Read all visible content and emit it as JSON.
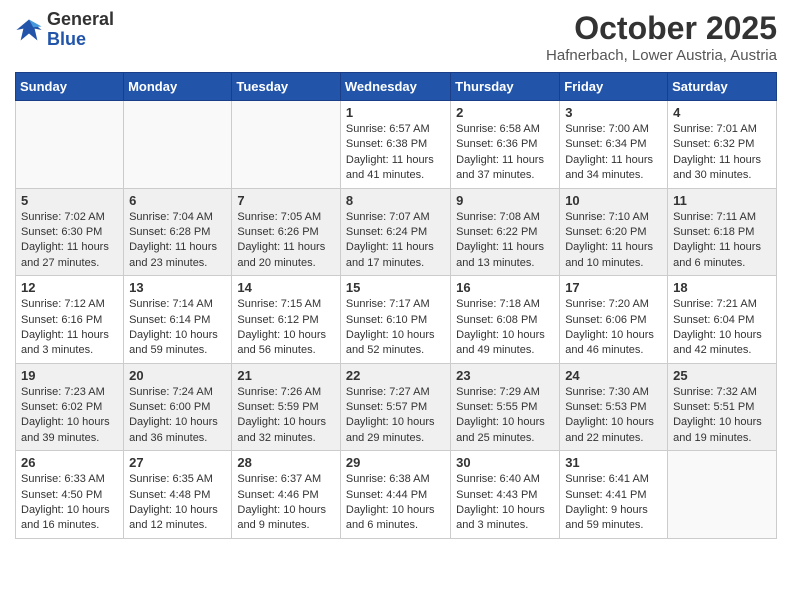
{
  "header": {
    "logo_general": "General",
    "logo_blue": "Blue",
    "month_title": "October 2025",
    "location": "Hafnerbach, Lower Austria, Austria"
  },
  "days_of_week": [
    "Sunday",
    "Monday",
    "Tuesday",
    "Wednesday",
    "Thursday",
    "Friday",
    "Saturday"
  ],
  "weeks": [
    [
      {
        "day": "",
        "info": ""
      },
      {
        "day": "",
        "info": ""
      },
      {
        "day": "",
        "info": ""
      },
      {
        "day": "1",
        "info": "Sunrise: 6:57 AM\nSunset: 6:38 PM\nDaylight: 11 hours\nand 41 minutes."
      },
      {
        "day": "2",
        "info": "Sunrise: 6:58 AM\nSunset: 6:36 PM\nDaylight: 11 hours\nand 37 minutes."
      },
      {
        "day": "3",
        "info": "Sunrise: 7:00 AM\nSunset: 6:34 PM\nDaylight: 11 hours\nand 34 minutes."
      },
      {
        "day": "4",
        "info": "Sunrise: 7:01 AM\nSunset: 6:32 PM\nDaylight: 11 hours\nand 30 minutes."
      }
    ],
    [
      {
        "day": "5",
        "info": "Sunrise: 7:02 AM\nSunset: 6:30 PM\nDaylight: 11 hours\nand 27 minutes."
      },
      {
        "day": "6",
        "info": "Sunrise: 7:04 AM\nSunset: 6:28 PM\nDaylight: 11 hours\nand 23 minutes."
      },
      {
        "day": "7",
        "info": "Sunrise: 7:05 AM\nSunset: 6:26 PM\nDaylight: 11 hours\nand 20 minutes."
      },
      {
        "day": "8",
        "info": "Sunrise: 7:07 AM\nSunset: 6:24 PM\nDaylight: 11 hours\nand 17 minutes."
      },
      {
        "day": "9",
        "info": "Sunrise: 7:08 AM\nSunset: 6:22 PM\nDaylight: 11 hours\nand 13 minutes."
      },
      {
        "day": "10",
        "info": "Sunrise: 7:10 AM\nSunset: 6:20 PM\nDaylight: 11 hours\nand 10 minutes."
      },
      {
        "day": "11",
        "info": "Sunrise: 7:11 AM\nSunset: 6:18 PM\nDaylight: 11 hours\nand 6 minutes."
      }
    ],
    [
      {
        "day": "12",
        "info": "Sunrise: 7:12 AM\nSunset: 6:16 PM\nDaylight: 11 hours\nand 3 minutes."
      },
      {
        "day": "13",
        "info": "Sunrise: 7:14 AM\nSunset: 6:14 PM\nDaylight: 10 hours\nand 59 minutes."
      },
      {
        "day": "14",
        "info": "Sunrise: 7:15 AM\nSunset: 6:12 PM\nDaylight: 10 hours\nand 56 minutes."
      },
      {
        "day": "15",
        "info": "Sunrise: 7:17 AM\nSunset: 6:10 PM\nDaylight: 10 hours\nand 52 minutes."
      },
      {
        "day": "16",
        "info": "Sunrise: 7:18 AM\nSunset: 6:08 PM\nDaylight: 10 hours\nand 49 minutes."
      },
      {
        "day": "17",
        "info": "Sunrise: 7:20 AM\nSunset: 6:06 PM\nDaylight: 10 hours\nand 46 minutes."
      },
      {
        "day": "18",
        "info": "Sunrise: 7:21 AM\nSunset: 6:04 PM\nDaylight: 10 hours\nand 42 minutes."
      }
    ],
    [
      {
        "day": "19",
        "info": "Sunrise: 7:23 AM\nSunset: 6:02 PM\nDaylight: 10 hours\nand 39 minutes."
      },
      {
        "day": "20",
        "info": "Sunrise: 7:24 AM\nSunset: 6:00 PM\nDaylight: 10 hours\nand 36 minutes."
      },
      {
        "day": "21",
        "info": "Sunrise: 7:26 AM\nSunset: 5:59 PM\nDaylight: 10 hours\nand 32 minutes."
      },
      {
        "day": "22",
        "info": "Sunrise: 7:27 AM\nSunset: 5:57 PM\nDaylight: 10 hours\nand 29 minutes."
      },
      {
        "day": "23",
        "info": "Sunrise: 7:29 AM\nSunset: 5:55 PM\nDaylight: 10 hours\nand 25 minutes."
      },
      {
        "day": "24",
        "info": "Sunrise: 7:30 AM\nSunset: 5:53 PM\nDaylight: 10 hours\nand 22 minutes."
      },
      {
        "day": "25",
        "info": "Sunrise: 7:32 AM\nSunset: 5:51 PM\nDaylight: 10 hours\nand 19 minutes."
      }
    ],
    [
      {
        "day": "26",
        "info": "Sunrise: 6:33 AM\nSunset: 4:50 PM\nDaylight: 10 hours\nand 16 minutes."
      },
      {
        "day": "27",
        "info": "Sunrise: 6:35 AM\nSunset: 4:48 PM\nDaylight: 10 hours\nand 12 minutes."
      },
      {
        "day": "28",
        "info": "Sunrise: 6:37 AM\nSunset: 4:46 PM\nDaylight: 10 hours\nand 9 minutes."
      },
      {
        "day": "29",
        "info": "Sunrise: 6:38 AM\nSunset: 4:44 PM\nDaylight: 10 hours\nand 6 minutes."
      },
      {
        "day": "30",
        "info": "Sunrise: 6:40 AM\nSunset: 4:43 PM\nDaylight: 10 hours\nand 3 minutes."
      },
      {
        "day": "31",
        "info": "Sunrise: 6:41 AM\nSunset: 4:41 PM\nDaylight: 9 hours\nand 59 minutes."
      },
      {
        "day": "",
        "info": ""
      }
    ]
  ],
  "shaded_rows": [
    1,
    3
  ]
}
